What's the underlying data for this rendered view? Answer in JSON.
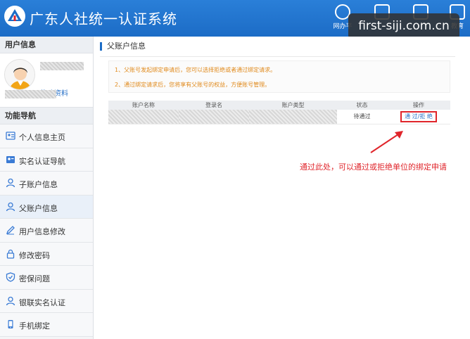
{
  "header": {
    "title": "广东人社统一认证系统",
    "nav": [
      {
        "label": "网办平",
        "icon": "network-office-icon"
      },
      {
        "label": "",
        "icon": "card-icon"
      },
      {
        "label": "",
        "icon": "calendar-icon"
      },
      {
        "label": "教育",
        "icon": "education-icon"
      }
    ],
    "brand_color": "#1c6cc6"
  },
  "watermark": "first-siji.com.cn",
  "sidebar": {
    "user_section_title": "用户信息",
    "edit_profile": "修改资料",
    "nav_title": "功能导航",
    "items": [
      {
        "label": "个人信息主页",
        "icon": "id-card-icon"
      },
      {
        "label": "实名认证导航",
        "icon": "id-photo-icon"
      },
      {
        "label": "子账户信息",
        "icon": "user-icon"
      },
      {
        "label": "父账户信息",
        "icon": "user-icon",
        "active": true
      },
      {
        "label": "用户信息修改",
        "icon": "pencil-icon"
      },
      {
        "label": "修改密码",
        "icon": "lock-icon"
      },
      {
        "label": "密保问题",
        "icon": "shield-icon"
      },
      {
        "label": "银联实名认证",
        "icon": "user-icon"
      },
      {
        "label": "手机绑定",
        "icon": "phone-icon"
      }
    ]
  },
  "main": {
    "title": "父账户信息",
    "notice": [
      "1、父账号发起绑定申请后，您可以选择拒绝或者通过绑定请求。",
      "2、通过绑定请求后，您将享有父账号的权益，方便账号管理。"
    ],
    "table": {
      "headers": [
        "账户名称",
        "登录名",
        "账户类型",
        "状态",
        "操作"
      ],
      "rows": [
        {
          "status": "待通过",
          "action": "通 过/拒 绝"
        }
      ]
    },
    "annotation": "通过此处，可以通过或拒绝单位的绑定申请",
    "annotation_color": "#e0252b"
  }
}
